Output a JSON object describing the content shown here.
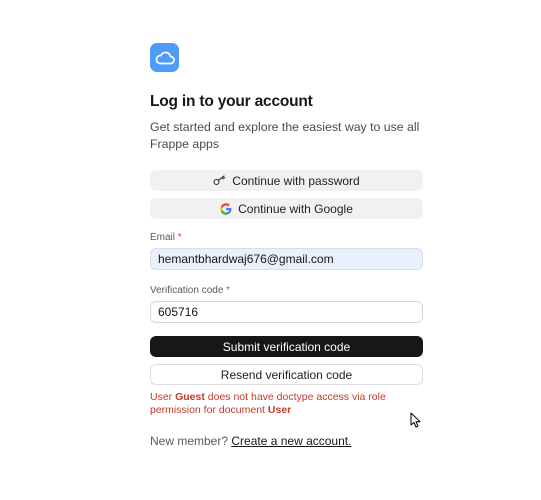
{
  "header": {
    "logo_icon": "cloud-icon",
    "title": "Log in to your account",
    "subtitle": "Get started and explore the easiest way to use all Frappe apps"
  },
  "auth_options": {
    "password_label": "Continue with password",
    "password_icon": "key-icon",
    "google_label": "Continue with Google",
    "google_icon": "google-icon"
  },
  "form": {
    "email_label": "Email",
    "email_value": "hemantbhardwaj676@gmail.com",
    "code_label": "Verification code",
    "code_value": "605716",
    "required_marker": "*",
    "submit_label": "Submit verification code",
    "resend_label": "Resend verification code"
  },
  "error": {
    "prefix": "User ",
    "user": "Guest",
    "middle": " does not have doctype access via role permission for document ",
    "doctype": "User"
  },
  "footer": {
    "prompt": "New member?",
    "link_label": "Create a new account."
  },
  "colors": {
    "accent": "#4f9cf7",
    "primary_button": "#171717",
    "error": "#c43a2b",
    "email_field_bg": "#e8f0fe"
  }
}
